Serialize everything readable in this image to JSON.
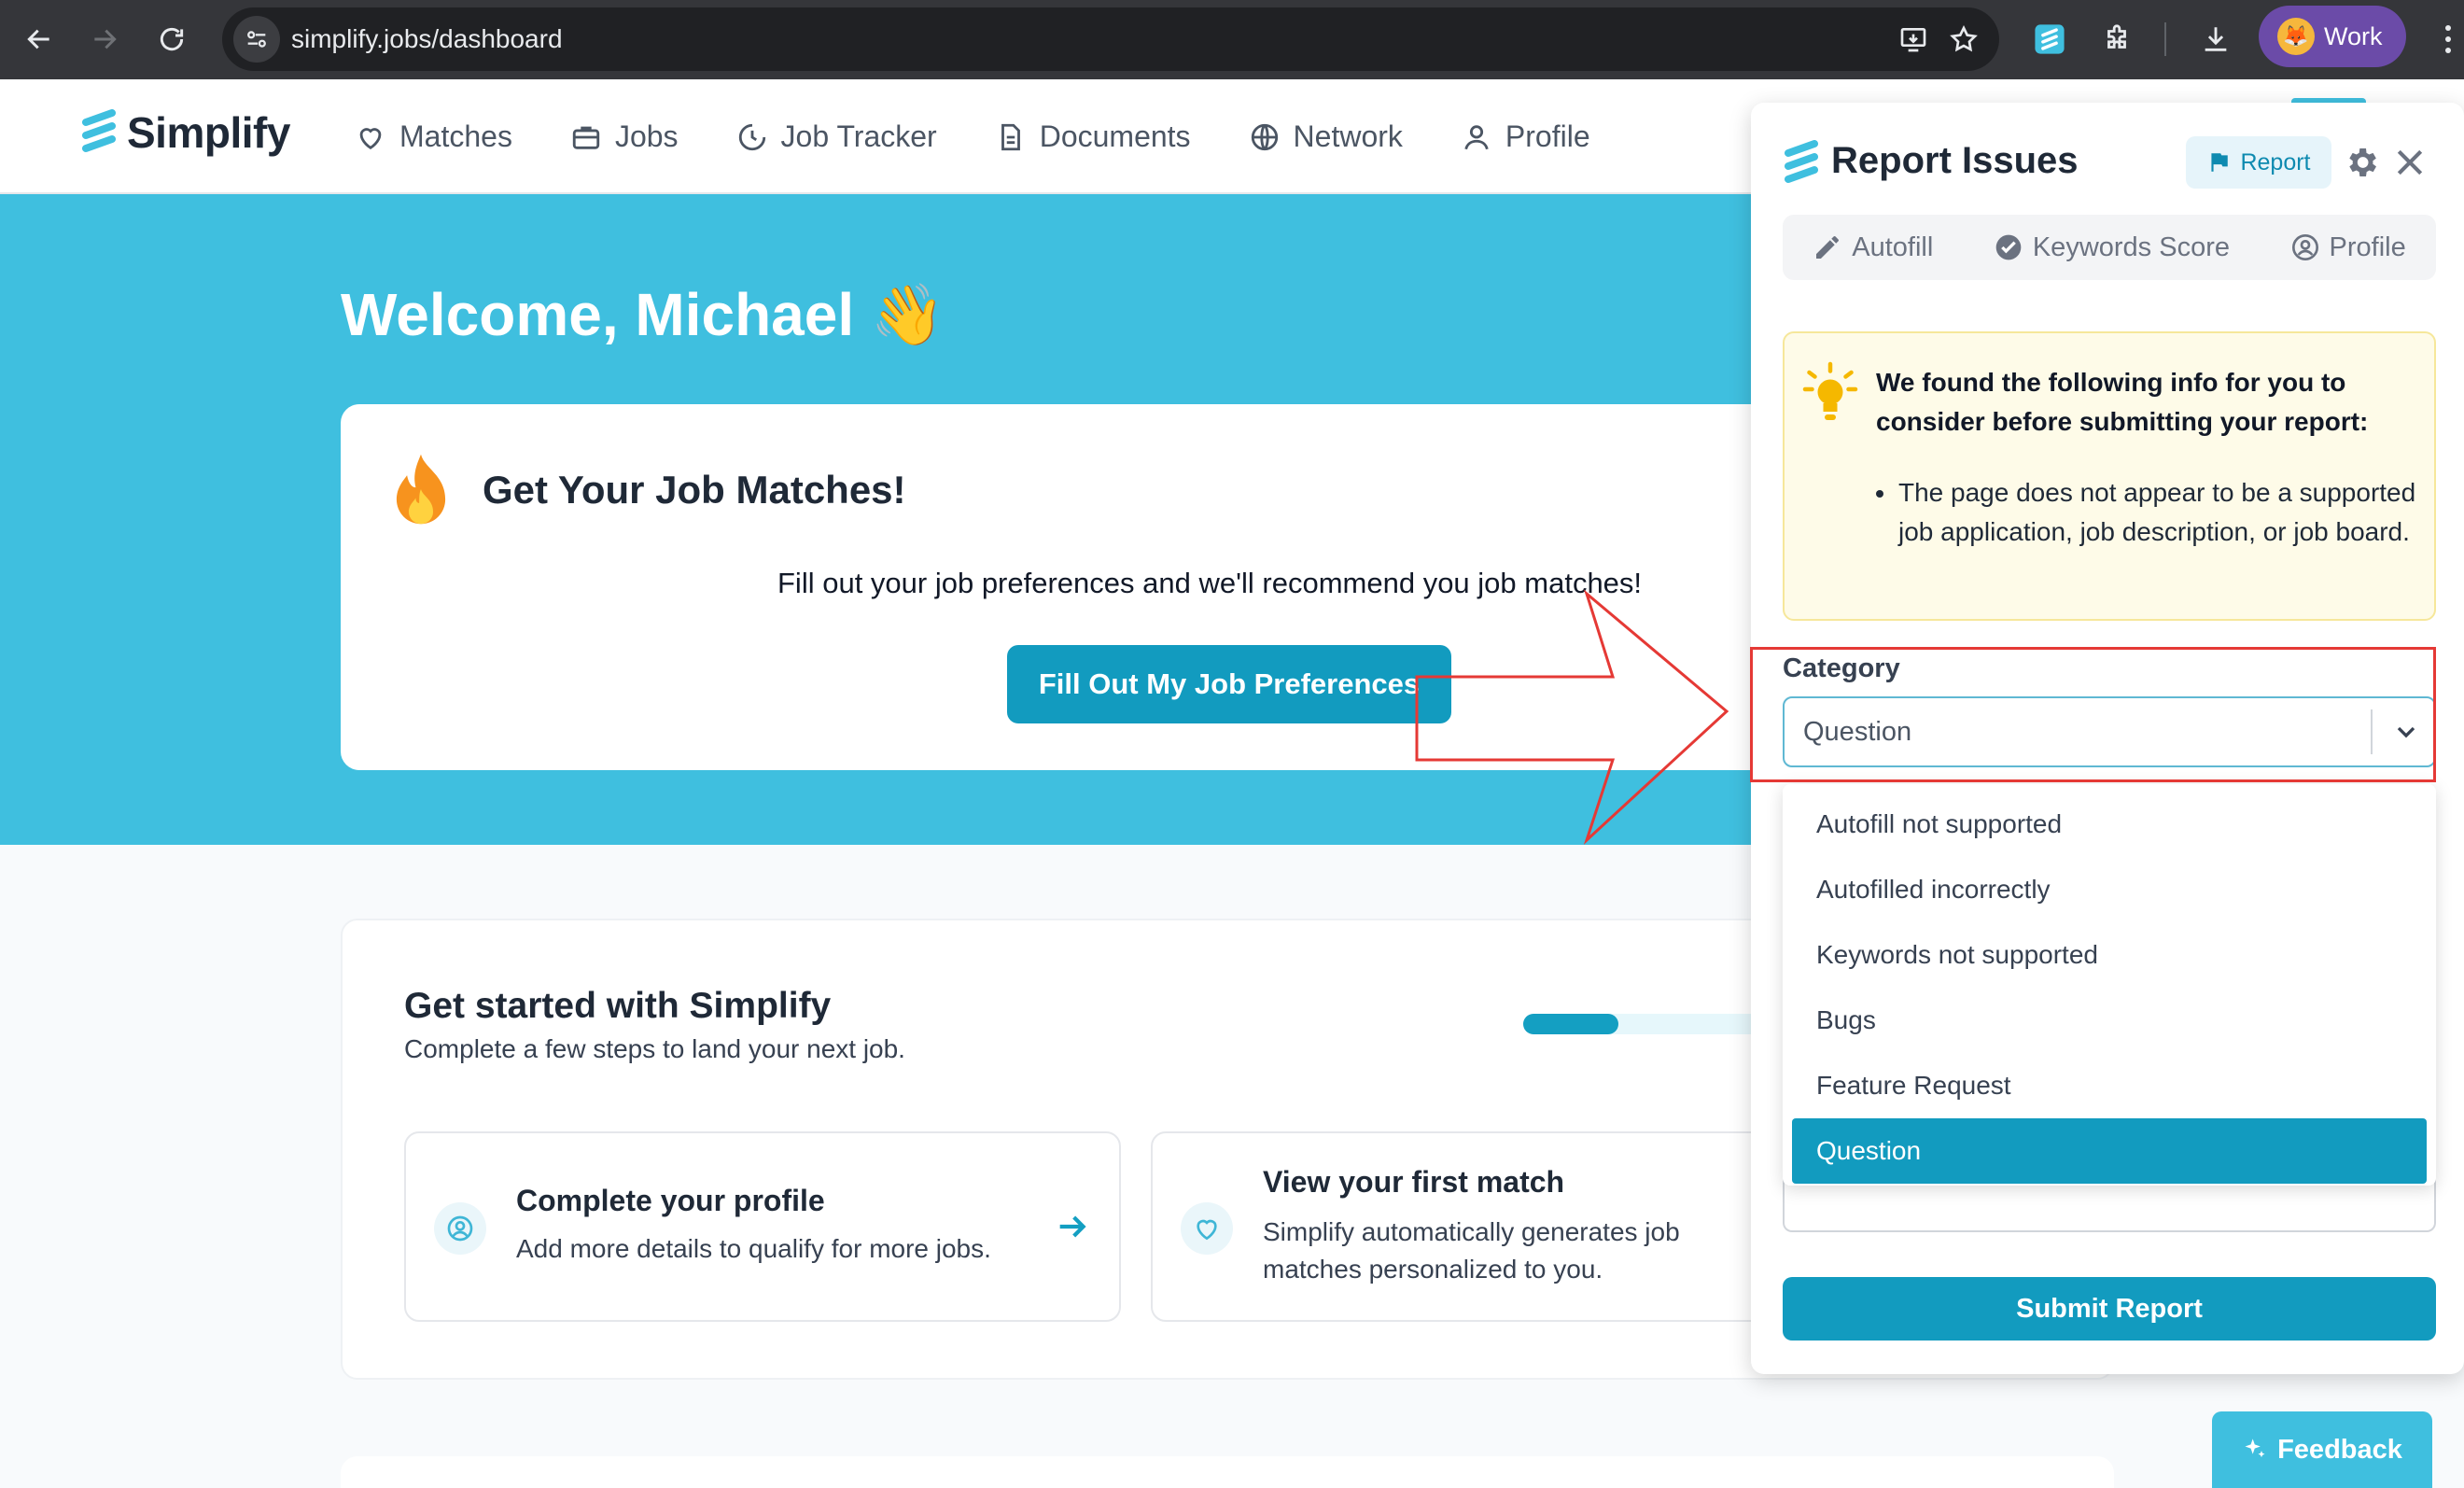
{
  "browser": {
    "url": "simplify.jobs/dashboard",
    "profile_label": "Work"
  },
  "nav": {
    "brand": "Simplify",
    "links": [
      "Matches",
      "Jobs",
      "Job Tracker",
      "Documents",
      "Network",
      "Profile"
    ]
  },
  "hero": {
    "welcome": "Welcome, Michael 👋",
    "matches_title": "Get Your Job Matches!",
    "matches_desc": "Fill out your job preferences and we'll recommend you job matches!",
    "matches_cta": "Fill Out My Job Preferences"
  },
  "getting_started": {
    "title": "Get started with Simplify",
    "subtitle": "Complete a few steps to land your next job.",
    "progress": 0.17,
    "steps": [
      {
        "title": "Complete your profile",
        "desc": "Add more details to qualify for more jobs."
      },
      {
        "title": "View your first match",
        "desc": "Simplify automatically generates job matches personalized to you."
      }
    ]
  },
  "panel": {
    "title": "Report Issues",
    "report_chip": "Report",
    "tabs": [
      "Autofill",
      "Keywords Score",
      "Profile"
    ],
    "info_heading": "We found the following info for you to consider before submitting your report:",
    "info_items": [
      "The page does not appear to be a supported job application, job description, or job board."
    ],
    "category_label": "Category",
    "category_value": "Question",
    "options": [
      "Autofill not supported",
      "Autofilled incorrectly",
      "Keywords not supported",
      "Bugs",
      "Feature Request",
      "Question"
    ],
    "selected_option": "Question",
    "submit": "Submit Report"
  },
  "feedback": "Feedback",
  "colors": {
    "brand": "#129bbf",
    "hero_bg": "#3fbfdf",
    "annotation": "#e53935"
  }
}
